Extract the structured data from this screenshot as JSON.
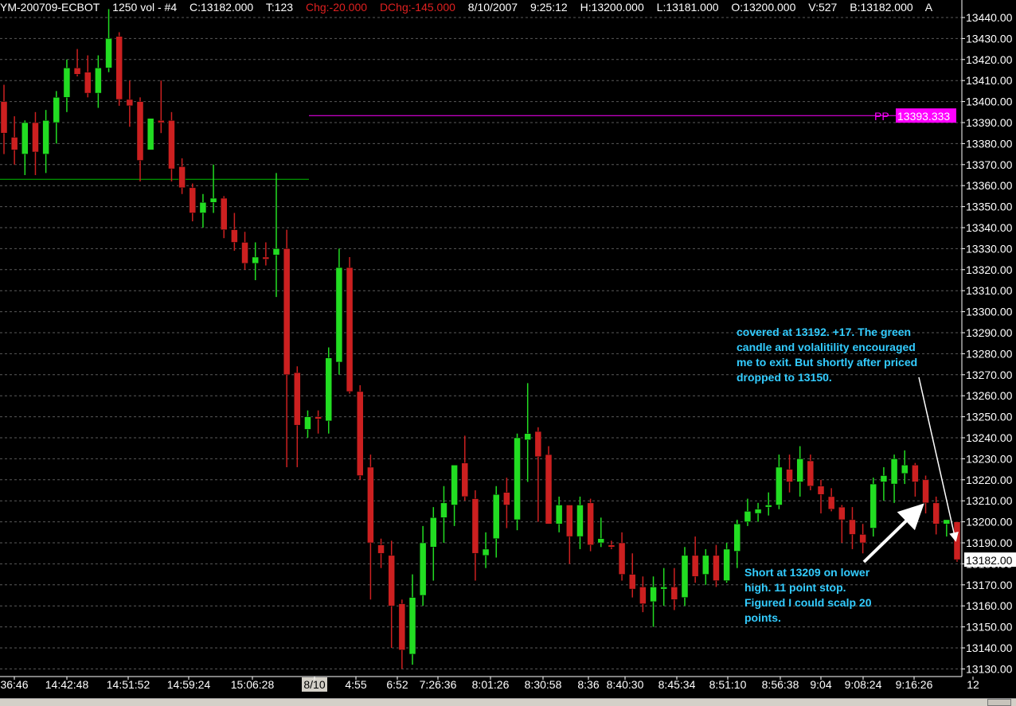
{
  "header": {
    "symbol": "YM-200709-ECBOT",
    "interval": "1250 vol - #4",
    "close": "C:13182.000",
    "ticks": "T:123",
    "chg": "Chg:-20.000",
    "dchg": "DChg:-145.000",
    "date": "8/10/2007",
    "time": "9:25:12",
    "high": "H:13200.000",
    "low": "L:13181.000",
    "open": "O:13200.000",
    "volume": "V:527",
    "bid": "B:13182.000",
    "ask": "A"
  },
  "price_axis": {
    "labels": [
      "13440.00",
      "13430.00",
      "13420.00",
      "13410.00",
      "13400.00",
      "13390.00",
      "13380.00",
      "13370.00",
      "13360.00",
      "13350.00",
      "13340.00",
      "13330.00",
      "13320.00",
      "13310.00",
      "13300.00",
      "13290.00",
      "13280.00",
      "13270.00",
      "13260.00",
      "13250.00",
      "13240.00",
      "13230.00",
      "13220.00",
      "13210.00",
      "13200.00",
      "13190.00",
      "13180.00",
      "13170.00",
      "13160.00",
      "13150.00",
      "13140.00",
      "13130.00"
    ],
    "last_price_tag": "13182.00"
  },
  "time_axis": {
    "labels": [
      "36:46",
      "14:42:48",
      "14:51:52",
      "14:59:24",
      "15:06:28",
      "8/10",
      "4:55",
      "6:52",
      "7:26:36",
      "8:01:26",
      "8:30:58",
      "8:36",
      "8:40:30",
      "8:45:34",
      "8:51:10",
      "8:56:38",
      "9:04",
      "9:08:24",
      "9:16:26",
      "12"
    ]
  },
  "pivot": {
    "label": "PP",
    "value": "13393.333"
  },
  "annotations": {
    "covered": [
      "covered at 13192.  +17.  The green",
      "candle and volalitility encouraged",
      "me to exit.  But shortly after priced",
      "dropped to 13150."
    ],
    "short": [
      "Short at 13209 on lower",
      "high.  11 point stop.",
      "Figured I could scalp 20",
      "points."
    ]
  },
  "colors": {
    "up": "#22dd22",
    "down": "#cc2020",
    "wick_up": "#22dd22",
    "wick_down": "#cc2020",
    "pivot": "#ff00ff",
    "support_line": "#00c000",
    "annotation_text": "#33ccff",
    "grid": "#5a5a5a",
    "axis_text": "#ffffff"
  },
  "chart_data": {
    "type": "candlestick",
    "ylim": [
      13126,
      13446
    ],
    "pivot_pp": 13393.333,
    "support_level": 13363,
    "last_price": 13182,
    "candles": [
      {
        "o": 13400,
        "h": 13408,
        "l": 13375,
        "c": 13385
      },
      {
        "o": 13383,
        "h": 13393,
        "l": 13370,
        "c": 13377
      },
      {
        "o": 13375,
        "h": 13391,
        "l": 13365,
        "c": 13390
      },
      {
        "o": 13390,
        "h": 13395,
        "l": 13365,
        "c": 13376
      },
      {
        "o": 13375,
        "h": 13396,
        "l": 13366,
        "c": 13391
      },
      {
        "o": 13390,
        "h": 13405,
        "l": 13380,
        "c": 13402
      },
      {
        "o": 13402,
        "h": 13420,
        "l": 13395,
        "c": 13416
      },
      {
        "o": 13416,
        "h": 13425,
        "l": 13412,
        "c": 13413
      },
      {
        "o": 13414,
        "h": 13422,
        "l": 13402,
        "c": 13404
      },
      {
        "o": 13404,
        "h": 13422,
        "l": 13397,
        "c": 13416
      },
      {
        "o": 13416,
        "h": 13444,
        "l": 13414,
        "c": 13430
      },
      {
        "o": 13431,
        "h": 13433,
        "l": 13398,
        "c": 13401
      },
      {
        "o": 13401,
        "h": 13410,
        "l": 13388,
        "c": 13398
      },
      {
        "o": 13400,
        "h": 13402,
        "l": 13362,
        "c": 13372
      },
      {
        "o": 13377,
        "h": 13392,
        "l": 13377,
        "c": 13392
      },
      {
        "o": 13391,
        "h": 13410,
        "l": 13385,
        "c": 13390
      },
      {
        "o": 13391,
        "h": 13395,
        "l": 13362,
        "c": 13368
      },
      {
        "o": 13369,
        "h": 13373,
        "l": 13356,
        "c": 13359
      },
      {
        "o": 13359,
        "h": 13361,
        "l": 13343,
        "c": 13347
      },
      {
        "o": 13347,
        "h": 13356,
        "l": 13340,
        "c": 13352
      },
      {
        "o": 13352,
        "h": 13370,
        "l": 13347,
        "c": 13354
      },
      {
        "o": 13354,
        "h": 13355,
        "l": 13335,
        "c": 13339
      },
      {
        "o": 13339,
        "h": 13347,
        "l": 13329,
        "c": 13333
      },
      {
        "o": 13333,
        "h": 13338,
        "l": 13320,
        "c": 13323
      },
      {
        "o": 13323,
        "h": 13333,
        "l": 13315,
        "c": 13326
      },
      {
        "o": 13326,
        "h": 13333,
        "l": 13322,
        "c": 13325
      },
      {
        "o": 13327,
        "h": 13366,
        "l": 13307,
        "c": 13330
      },
      {
        "o": 13330,
        "h": 13339,
        "l": 13226,
        "c": 13270
      },
      {
        "o": 13271,
        "h": 13274,
        "l": 13226,
        "c": 13246
      },
      {
        "o": 13244,
        "h": 13253,
        "l": 13240,
        "c": 13250
      },
      {
        "o": 13250,
        "h": 13253,
        "l": 13242,
        "c": 13249
      },
      {
        "o": 13248,
        "h": 13283,
        "l": 13242,
        "c": 13278
      },
      {
        "o": 13276,
        "h": 13330,
        "l": 13270,
        "c": 13321
      },
      {
        "o": 13321,
        "h": 13326,
        "l": 13261,
        "c": 13262
      },
      {
        "o": 13262,
        "h": 13265,
        "l": 13220,
        "c": 13222
      },
      {
        "o": 13226,
        "h": 13232,
        "l": 13163,
        "c": 13190
      },
      {
        "o": 13189,
        "h": 13192,
        "l": 13178,
        "c": 13185
      },
      {
        "o": 13184,
        "h": 13191,
        "l": 13140,
        "c": 13160
      },
      {
        "o": 13161,
        "h": 13163,
        "l": 13130,
        "c": 13139
      },
      {
        "o": 13137,
        "h": 13175,
        "l": 13132,
        "c": 13164
      },
      {
        "o": 13165,
        "h": 13198,
        "l": 13160,
        "c": 13190
      },
      {
        "o": 13188,
        "h": 13207,
        "l": 13172,
        "c": 13202
      },
      {
        "o": 13202,
        "h": 13217,
        "l": 13190,
        "c": 13209
      },
      {
        "o": 13208,
        "h": 13226,
        "l": 13198,
        "c": 13227
      },
      {
        "o": 13228,
        "h": 13241,
        "l": 13210,
        "c": 13212
      },
      {
        "o": 13211,
        "h": 13215,
        "l": 13172,
        "c": 13185
      },
      {
        "o": 13184,
        "h": 13195,
        "l": 13178,
        "c": 13187
      },
      {
        "o": 13192,
        "h": 13217,
        "l": 13183,
        "c": 13213
      },
      {
        "o": 13214,
        "h": 13221,
        "l": 13197,
        "c": 13208
      },
      {
        "o": 13201,
        "h": 13242,
        "l": 13196,
        "c": 13240
      },
      {
        "o": 13239,
        "h": 13266,
        "l": 13219,
        "c": 13242
      },
      {
        "o": 13243,
        "h": 13245,
        "l": 13200,
        "c": 13231
      },
      {
        "o": 13232,
        "h": 13236,
        "l": 13199,
        "c": 13199
      },
      {
        "o": 13199,
        "h": 13212,
        "l": 13195,
        "c": 13208
      },
      {
        "o": 13208,
        "h": 13208,
        "l": 13180,
        "c": 13193
      },
      {
        "o": 13193,
        "h": 13212,
        "l": 13187,
        "c": 13208
      },
      {
        "o": 13209,
        "h": 13211,
        "l": 13186,
        "c": 13189
      },
      {
        "o": 13190,
        "h": 13202,
        "l": 13188,
        "c": 13192
      },
      {
        "o": 13189,
        "h": 13191,
        "l": 13187,
        "c": 13188
      },
      {
        "o": 13190,
        "h": 13195,
        "l": 13172,
        "c": 13175
      },
      {
        "o": 13175,
        "h": 13185,
        "l": 13164,
        "c": 13168
      },
      {
        "o": 13169,
        "h": 13174,
        "l": 13157,
        "c": 13161
      },
      {
        "o": 13162,
        "h": 13174,
        "l": 13150,
        "c": 13169
      },
      {
        "o": 13168,
        "h": 13178,
        "l": 13160,
        "c": 13169
      },
      {
        "o": 13169,
        "h": 13178,
        "l": 13158,
        "c": 13163
      },
      {
        "o": 13164,
        "h": 13188,
        "l": 13160,
        "c": 13184
      },
      {
        "o": 13184,
        "h": 13193,
        "l": 13171,
        "c": 13174
      },
      {
        "o": 13175,
        "h": 13187,
        "l": 13170,
        "c": 13184
      },
      {
        "o": 13184,
        "h": 13189,
        "l": 13169,
        "c": 13172
      },
      {
        "o": 13172,
        "h": 13190,
        "l": 13171,
        "c": 13187
      },
      {
        "o": 13186,
        "h": 13201,
        "l": 13178,
        "c": 13199
      },
      {
        "o": 13200,
        "h": 13211,
        "l": 13198,
        "c": 13205
      },
      {
        "o": 13204,
        "h": 13209,
        "l": 13200,
        "c": 13206
      },
      {
        "o": 13207,
        "h": 13214,
        "l": 13203,
        "c": 13208
      },
      {
        "o": 13208,
        "h": 13232,
        "l": 13206,
        "c": 13226
      },
      {
        "o": 13225,
        "h": 13232,
        "l": 13214,
        "c": 13219
      },
      {
        "o": 13219,
        "h": 13236,
        "l": 13212,
        "c": 13230
      },
      {
        "o": 13229,
        "h": 13232,
        "l": 13215,
        "c": 13217
      },
      {
        "o": 13217,
        "h": 13220,
        "l": 13204,
        "c": 13213
      },
      {
        "o": 13212,
        "h": 13216,
        "l": 13205,
        "c": 13206
      },
      {
        "o": 13207,
        "h": 13208,
        "l": 13190,
        "c": 13201
      },
      {
        "o": 13201,
        "h": 13207,
        "l": 13187,
        "c": 13194
      },
      {
        "o": 13194,
        "h": 13199,
        "l": 13185,
        "c": 13190
      },
      {
        "o": 13197,
        "h": 13221,
        "l": 13193,
        "c": 13218
      },
      {
        "o": 13219,
        "h": 13226,
        "l": 13210,
        "c": 13222
      },
      {
        "o": 13218,
        "h": 13232,
        "l": 13209,
        "c": 13230
      },
      {
        "o": 13223,
        "h": 13234,
        "l": 13218,
        "c": 13227
      },
      {
        "o": 13227,
        "h": 13228,
        "l": 13212,
        "c": 13219
      },
      {
        "o": 13220,
        "h": 13222,
        "l": 13204,
        "c": 13209
      },
      {
        "o": 13209,
        "h": 13212,
        "l": 13194,
        "c": 13199
      },
      {
        "o": 13199,
        "h": 13201,
        "l": 13193,
        "c": 13201
      },
      {
        "o": 13200,
        "h": 13200,
        "l": 13181,
        "c": 13182
      }
    ]
  }
}
